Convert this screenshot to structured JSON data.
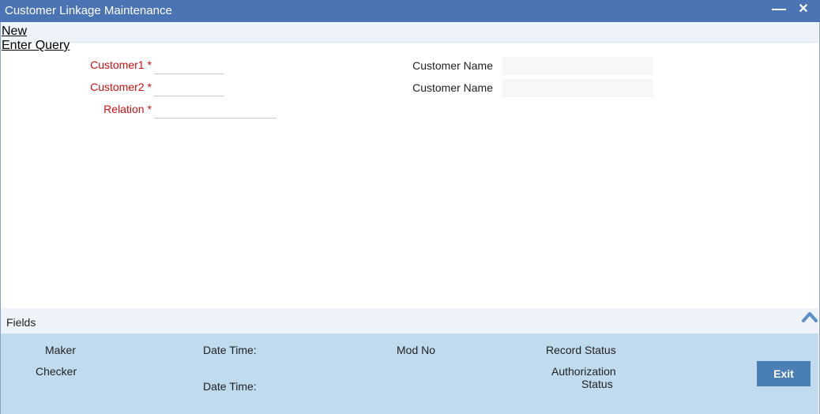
{
  "window": {
    "title": "Customer Linkage Maintenance",
    "minimize_glyph": "▬",
    "close_glyph": "✕"
  },
  "menu": {
    "new_label": "New",
    "enter_query_label": "Enter Query"
  },
  "form": {
    "customer1_label": "Customer1",
    "customer1_value": "",
    "customer2_label": "Customer2",
    "customer2_value": "",
    "relation_label": "Relation",
    "relation_value": "",
    "required_mark": "*",
    "customer_name_label_1": "Customer Name",
    "customer_name_value_1": "",
    "customer_name_label_2": "Customer Name",
    "customer_name_value_2": ""
  },
  "fields_bar": {
    "label": "Fields",
    "toggle_icon": "chevron-up-icon"
  },
  "audit": {
    "maker_label": "Maker",
    "checker_label": "Checker",
    "date_time_label_1": "Date Time:",
    "date_time_label_2": "Date Time:",
    "mod_no_label": "Mod No",
    "record_status_label": "Record Status",
    "authorization_label": "Authorization",
    "status_label": "Status",
    "exit_label": "Exit"
  },
  "colors": {
    "titlebar": "#4a74b4",
    "required_label": "#cc1111",
    "audit_panel": "#c0dbee",
    "exit_button": "#4a7fb5"
  }
}
